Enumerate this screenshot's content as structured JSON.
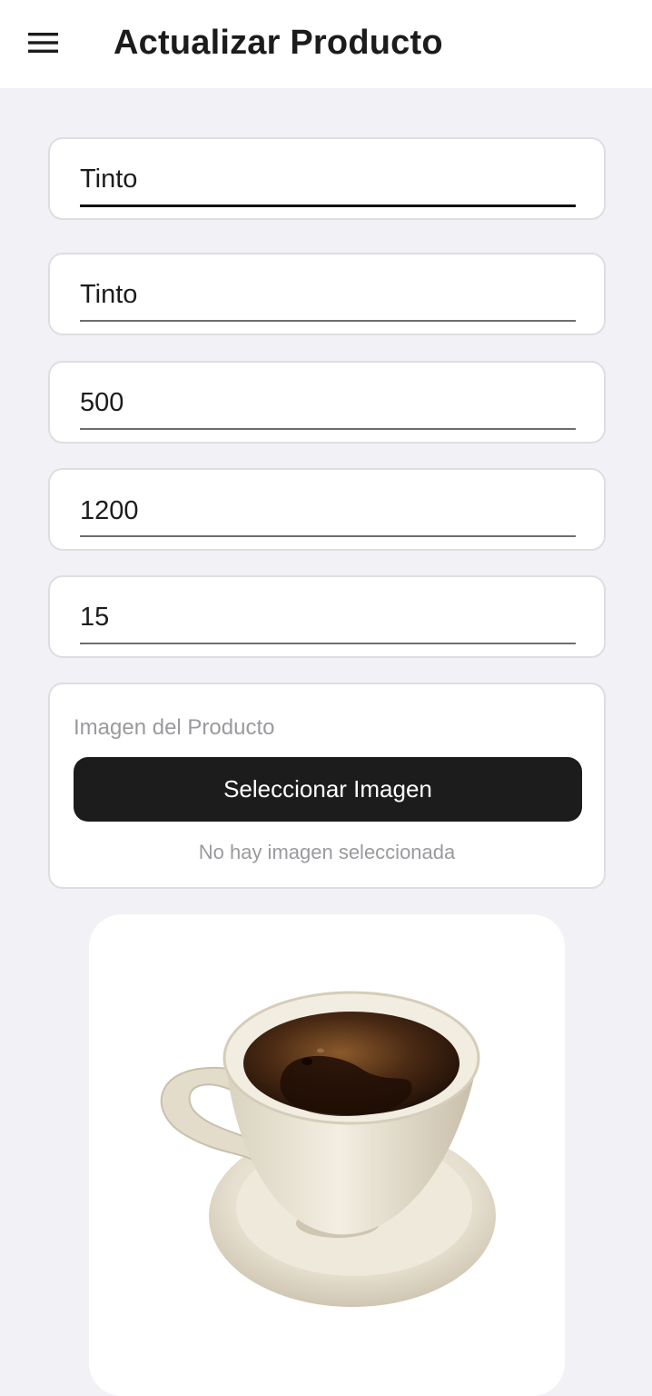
{
  "header": {
    "title": "Actualizar Producto",
    "menu_icon": "hamburger-menu-icon"
  },
  "form": {
    "fields": [
      {
        "value": "Tinto",
        "focused": true
      },
      {
        "value": "Tinto",
        "focused": false
      },
      {
        "value": "500",
        "focused": false
      },
      {
        "value": "1200",
        "focused": false
      },
      {
        "value": "15",
        "focused": false
      }
    ]
  },
  "image_section": {
    "label": "Imagen del Producto",
    "button_label": "Seleccionar Imagen",
    "status": "No hay imagen seleccionada"
  },
  "preview": {
    "image": "coffee-cup-image"
  },
  "colors": {
    "background": "#f1f1f6",
    "surface": "#ffffff",
    "primary_button": "#1c1c1c",
    "muted_text": "#9a9a9e"
  }
}
